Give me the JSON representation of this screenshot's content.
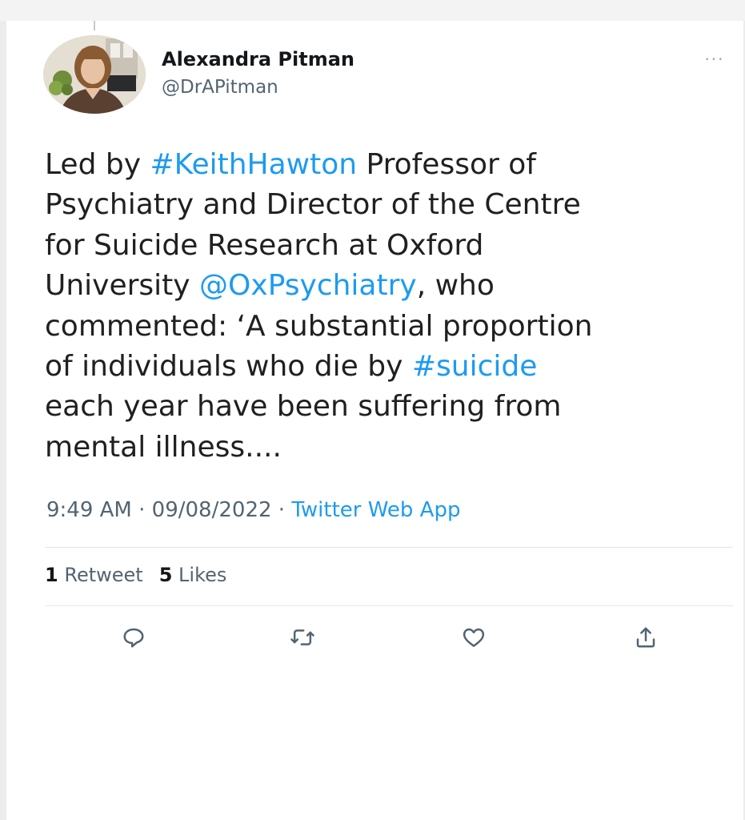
{
  "tweet": {
    "author": {
      "display_name": "Alexandra Pitman",
      "handle": "@DrAPitman"
    },
    "more_label": "···",
    "text_lines": [
      [
        {
          "t": "Led by "
        },
        {
          "t": "#KeithHawton",
          "link": true
        },
        {
          "t": " Professor of"
        }
      ],
      [
        {
          "t": "Psychiatry and Director of the Centre"
        }
      ],
      [
        {
          "t": "for Suicide Research at Oxford"
        }
      ],
      [
        {
          "t": "University "
        },
        {
          "t": "@OxPsychiatry",
          "link": true
        },
        {
          "t": ", who"
        }
      ],
      [
        {
          "t": "commented: ‘A substantial proportion"
        }
      ],
      [
        {
          "t": "of individuals who die by "
        },
        {
          "t": "#suicide",
          "link": true
        }
      ],
      [
        {
          "t": "each year have been suffering from"
        }
      ],
      [
        {
          "t": "mental illness...."
        }
      ]
    ],
    "time": "9:49 AM",
    "date": "09/08/2022",
    "separator": " · ",
    "source": "Twitter Web App",
    "stats": {
      "retweets_count": "1",
      "retweets_label": "Retweet",
      "likes_count": "5",
      "likes_label": "Likes"
    },
    "actions": [
      "reply-icon",
      "retweet-icon",
      "like-icon",
      "share-icon"
    ]
  },
  "colors": {
    "link": "#1d9bf0",
    "secondary_text": "#536471",
    "icon": "#536471"
  }
}
